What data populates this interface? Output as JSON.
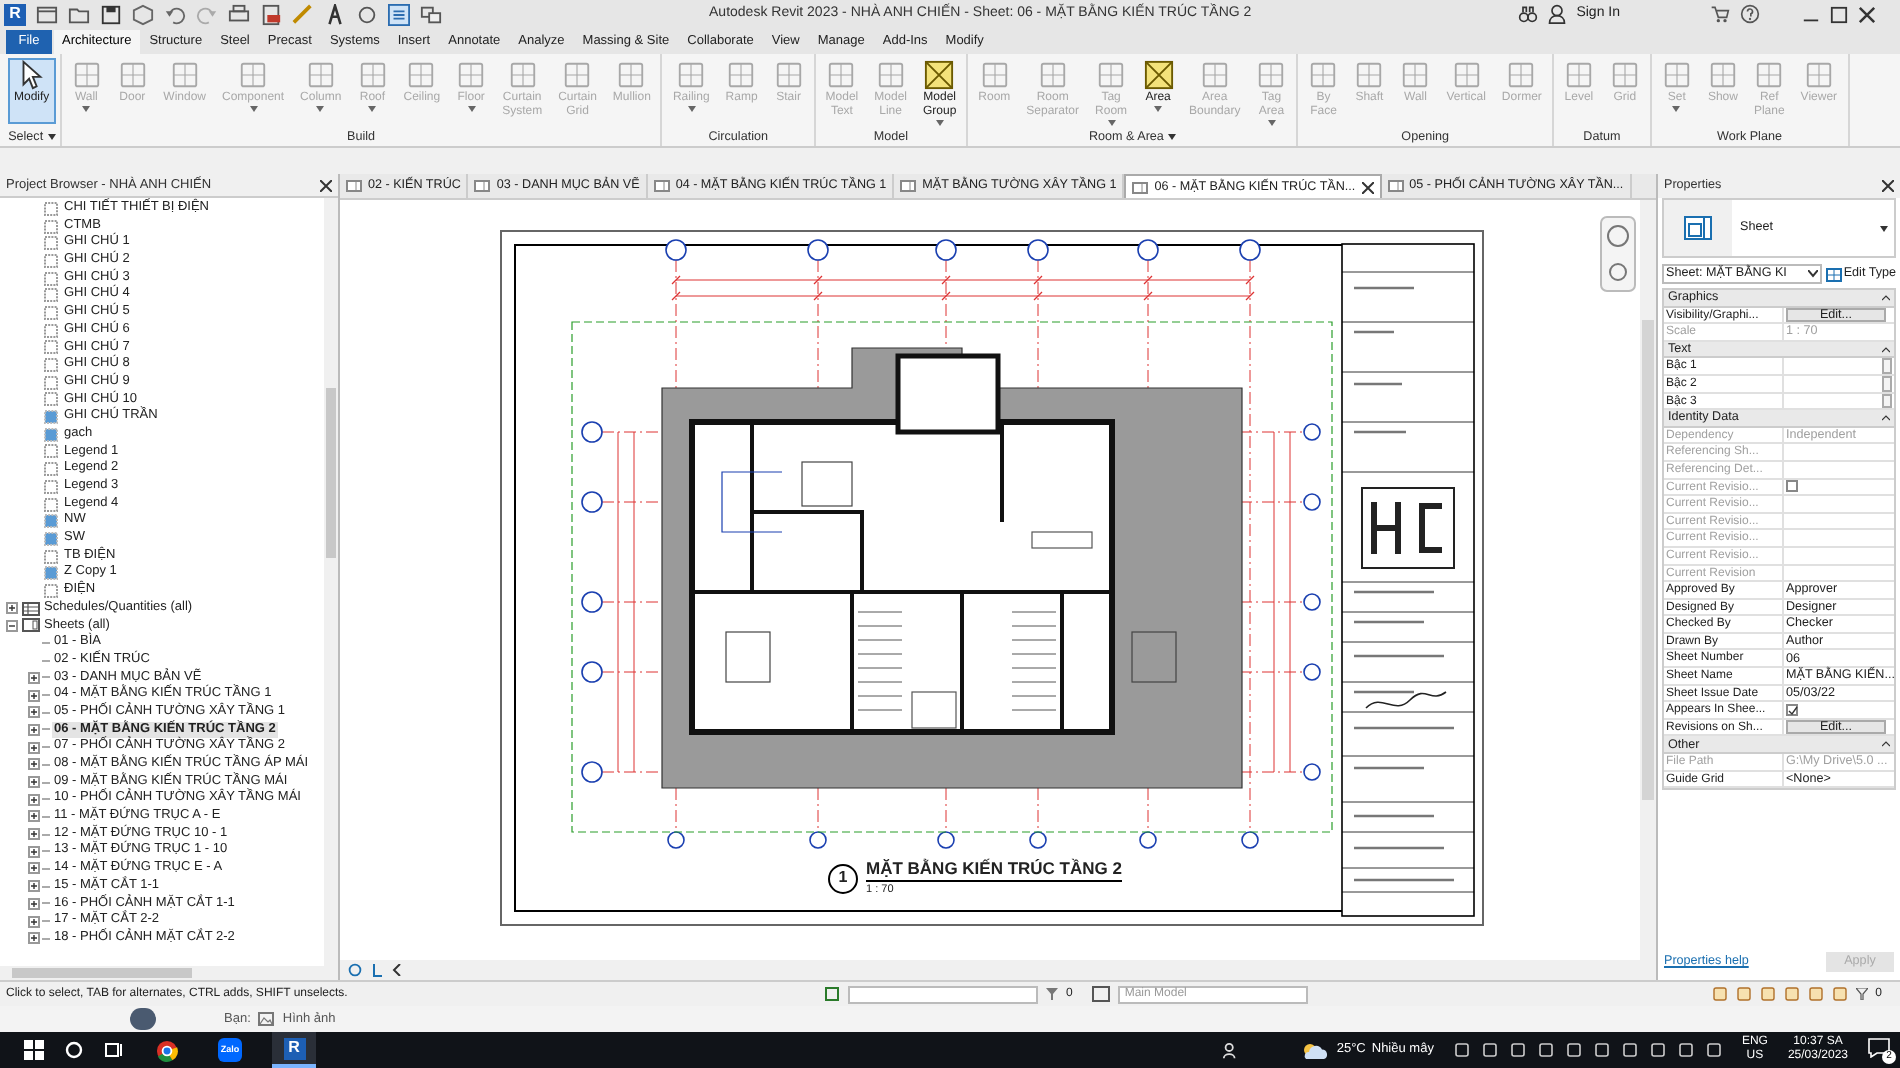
{
  "app": {
    "logo": "R",
    "title": "Autodesk Revit 2023 - NHÀ ANH CHIẾN - Sheet: 06 - MẶT BẰNG KIẾN TRÚC TẦNG 2",
    "sign_in": "Sign In"
  },
  "ribbon_tabs": [
    {
      "label": "File",
      "selected": false,
      "kind": "file"
    },
    {
      "label": "Architecture",
      "selected": true,
      "kind": "tab"
    },
    {
      "label": "Structure",
      "selected": false,
      "kind": "tab"
    },
    {
      "label": "Steel",
      "selected": false,
      "kind": "tab"
    },
    {
      "label": "Precast",
      "selected": false,
      "kind": "tab"
    },
    {
      "label": "Systems",
      "selected": false,
      "kind": "tab"
    },
    {
      "label": "Insert",
      "selected": false,
      "kind": "tab"
    },
    {
      "label": "Annotate",
      "selected": false,
      "kind": "tab"
    },
    {
      "label": "Analyze",
      "selected": false,
      "kind": "tab"
    },
    {
      "label": "Massing & Site",
      "selected": false,
      "kind": "tab"
    },
    {
      "label": "Collaborate",
      "selected": false,
      "kind": "tab"
    },
    {
      "label": "View",
      "selected": false,
      "kind": "tab"
    },
    {
      "label": "Manage",
      "selected": false,
      "kind": "tab"
    },
    {
      "label": "Add-Ins",
      "selected": false,
      "kind": "tab"
    },
    {
      "label": "Modify",
      "selected": false,
      "kind": "tab"
    }
  ],
  "ribbon_groups": [
    {
      "label": "Select",
      "menu": true,
      "buttons": [
        {
          "label": "Modify",
          "pressed": true,
          "disabled": false,
          "dropdown": false
        }
      ]
    },
    {
      "label": "Build",
      "menu": false,
      "buttons": [
        {
          "label": "Wall",
          "pressed": false,
          "disabled": true,
          "dropdown": true
        },
        {
          "label": "Door",
          "pressed": false,
          "disabled": true,
          "dropdown": false
        },
        {
          "label": "Window",
          "pressed": false,
          "disabled": true,
          "dropdown": false
        },
        {
          "label": "Component",
          "pressed": false,
          "disabled": true,
          "dropdown": true
        },
        {
          "label": "Column",
          "pressed": false,
          "disabled": true,
          "dropdown": true
        },
        {
          "label": "Roof",
          "pressed": false,
          "disabled": true,
          "dropdown": true
        },
        {
          "label": "Ceiling",
          "pressed": false,
          "disabled": true,
          "dropdown": false
        },
        {
          "label": "Floor",
          "pressed": false,
          "disabled": true,
          "dropdown": true
        },
        {
          "label": "Curtain System",
          "pressed": false,
          "disabled": true,
          "dropdown": false
        },
        {
          "label": "Curtain Grid",
          "pressed": false,
          "disabled": true,
          "dropdown": false
        },
        {
          "label": "Mullion",
          "pressed": false,
          "disabled": true,
          "dropdown": false
        }
      ]
    },
    {
      "label": "Circulation",
      "menu": false,
      "buttons": [
        {
          "label": "Railing",
          "pressed": false,
          "disabled": true,
          "dropdown": true
        },
        {
          "label": "Ramp",
          "pressed": false,
          "disabled": true,
          "dropdown": false
        },
        {
          "label": "Stair",
          "pressed": false,
          "disabled": true,
          "dropdown": false
        }
      ]
    },
    {
      "label": "Model",
      "menu": false,
      "buttons": [
        {
          "label": "Model Text",
          "pressed": false,
          "disabled": true,
          "dropdown": false
        },
        {
          "label": "Model Line",
          "pressed": false,
          "disabled": true,
          "dropdown": false
        },
        {
          "label": "Model Group",
          "pressed": false,
          "disabled": false,
          "dropdown": true
        }
      ]
    },
    {
      "label": "Room & Area",
      "menu": true,
      "buttons": [
        {
          "label": "Room",
          "pressed": false,
          "disabled": true,
          "dropdown": false
        },
        {
          "label": "Room Separator",
          "pressed": false,
          "disabled": true,
          "dropdown": false
        },
        {
          "label": "Tag Room",
          "pressed": false,
          "disabled": true,
          "dropdown": true
        },
        {
          "label": "Area",
          "pressed": false,
          "disabled": false,
          "dropdown": true
        },
        {
          "label": "Area Boundary",
          "pressed": false,
          "disabled": true,
          "dropdown": false
        },
        {
          "label": "Tag Area",
          "pressed": false,
          "disabled": true,
          "dropdown": true
        }
      ]
    },
    {
      "label": "Opening",
      "menu": false,
      "buttons": [
        {
          "label": "By Face",
          "pressed": false,
          "disabled": true,
          "dropdown": false
        },
        {
          "label": "Shaft",
          "pressed": false,
          "disabled": true,
          "dropdown": false
        },
        {
          "label": "Wall",
          "pressed": false,
          "disabled": true,
          "dropdown": false
        },
        {
          "label": "Vertical",
          "pressed": false,
          "disabled": true,
          "dropdown": false
        },
        {
          "label": "Dormer",
          "pressed": false,
          "disabled": true,
          "dropdown": false
        }
      ]
    },
    {
      "label": "Datum",
      "menu": false,
      "buttons": [
        {
          "label": "Level",
          "pressed": false,
          "disabled": true,
          "dropdown": false
        },
        {
          "label": "Grid",
          "pressed": false,
          "disabled": true,
          "dropdown": false
        }
      ]
    },
    {
      "label": "Work Plane",
      "menu": false,
      "buttons": [
        {
          "label": "Set",
          "pressed": false,
          "disabled": true,
          "dropdown": true
        },
        {
          "label": "Show",
          "pressed": false,
          "disabled": true,
          "dropdown": false
        },
        {
          "label": "Ref Plane",
          "pressed": false,
          "disabled": true,
          "dropdown": false
        },
        {
          "label": "Viewer",
          "pressed": false,
          "disabled": true,
          "dropdown": false
        }
      ]
    }
  ],
  "project_browser": {
    "title": "Project Browser - NHÀ ANH CHIẾN",
    "views": [
      {
        "label": "CHI TIẾT THIẾT BỊ ĐIỆN",
        "kind": "view"
      },
      {
        "label": "CTMB",
        "kind": "view"
      },
      {
        "label": "GHI CHÚ 1",
        "kind": "view"
      },
      {
        "label": "GHI CHÚ 2",
        "kind": "view"
      },
      {
        "label": "GHI CHÚ 3",
        "kind": "view"
      },
      {
        "label": "GHI CHÚ 4",
        "kind": "view"
      },
      {
        "label": "GHI CHÚ 5",
        "kind": "view"
      },
      {
        "label": "GHI CHÚ 6",
        "kind": "view"
      },
      {
        "label": "GHI CHÚ 7",
        "kind": "view"
      },
      {
        "label": "GHI CHÚ 8",
        "kind": "view"
      },
      {
        "label": "GHI CHÚ 9",
        "kind": "view"
      },
      {
        "label": "GHI CHÚ 10",
        "kind": "view"
      },
      {
        "label": "GHI CHÚ TRẦN",
        "kind": "view-filled"
      },
      {
        "label": "gach",
        "kind": "view-filled"
      },
      {
        "label": "Legend 1",
        "kind": "view"
      },
      {
        "label": "Legend 2",
        "kind": "view"
      },
      {
        "label": "Legend 3",
        "kind": "view"
      },
      {
        "label": "Legend 4",
        "kind": "view"
      },
      {
        "label": "NW",
        "kind": "view-filled"
      },
      {
        "label": "SW",
        "kind": "view-filled"
      },
      {
        "label": "TB ĐIỆN",
        "kind": "view"
      },
      {
        "label": "Z Copy 1",
        "kind": "view-filled"
      },
      {
        "label": "ĐIỆN",
        "kind": "view"
      }
    ],
    "nodes": [
      {
        "label": "Schedules/Quantities (all)",
        "kind": "schedules",
        "expanded": false
      },
      {
        "label": "Sheets (all)",
        "kind": "sheets",
        "expanded": true,
        "children": [
          {
            "label": "01 - BÌA",
            "has_children": false,
            "selected": false
          },
          {
            "label": "02 - KIẾN TRÚC",
            "has_children": false,
            "selected": false
          },
          {
            "label": "03 - DANH MỤC BẢN VẼ",
            "has_children": true,
            "selected": false
          },
          {
            "label": "04 - MẶT BẰNG KIẾN TRÚC TẦNG 1",
            "has_children": true,
            "selected": false
          },
          {
            "label": "05 - PHỐI CẢNH TƯỜNG XÂY TẦNG 1",
            "has_children": true,
            "selected": false
          },
          {
            "label": "06 - MẶT BẰNG KIẾN TRÚC TẦNG 2",
            "has_children": true,
            "selected": true
          },
          {
            "label": "07 - PHỐI CẢNH TƯỜNG XÂY TẦNG 2",
            "has_children": true,
            "selected": false
          },
          {
            "label": "08 - MẶT BẰNG KIẾN TRÚC TẦNG ÁP MÁI",
            "has_children": true,
            "selected": false
          },
          {
            "label": "09 - MẶT BẰNG KIẾN TRÚC TẦNG MÁI",
            "has_children": true,
            "selected": false
          },
          {
            "label": "10 - PHỐI CẢNH TƯỜNG XÂY TẦNG MÁI",
            "has_children": true,
            "selected": false
          },
          {
            "label": "11 - MẶT ĐỨNG TRỤC A - E",
            "has_children": true,
            "selected": false
          },
          {
            "label": "12 - MẶT ĐỨNG TRỤC 10 - 1",
            "has_children": true,
            "selected": false
          },
          {
            "label": "13 - MẶT ĐỨNG TRỤC 1 - 10",
            "has_children": true,
            "selected": false
          },
          {
            "label": "14 - MẶT ĐỨNG TRỤC E - A",
            "has_children": true,
            "selected": false
          },
          {
            "label": "15 - MẶT CẮT 1-1",
            "has_children": true,
            "selected": false
          },
          {
            "label": "16 - PHỐI CẢNH MẶT CẮT 1-1",
            "has_children": true,
            "selected": false
          },
          {
            "label": "17 - MẶT CẮT 2-2",
            "has_children": true,
            "selected": false
          },
          {
            "label": "18 - PHỐI CẢNH MẶT CẮT 2-2",
            "has_children": true,
            "selected": false
          }
        ]
      }
    ]
  },
  "view_tabs": [
    {
      "label": "02 - KIẾN TRÚC",
      "selected": false
    },
    {
      "label": "03 - DANH MỤC BẢN VẼ",
      "selected": false
    },
    {
      "label": "04 - MẶT BẰNG KIẾN TRÚC TẦNG 1",
      "selected": false
    },
    {
      "label": "MẶT BẰNG TƯỜNG XÂY TẦNG 1",
      "selected": false
    },
    {
      "label": "06 - MẶT BẰNG KIẾN TRÚC TẦN...",
      "selected": true
    },
    {
      "label": "05 - PHỐI CẢNH TƯỜNG XÂY TẦN...",
      "selected": false
    }
  ],
  "sheet_view": {
    "view_number": "1",
    "view_name": "MẶT BẰNG KIẾN TRÚC TẦNG 2",
    "scale": "1 : 70"
  },
  "properties": {
    "title": "Properties",
    "type_name": "Sheet",
    "instance_selector": "Sheet: MẶT BẰNG KI",
    "edit_type": "Edit Type",
    "groups": [
      {
        "name": "Graphics",
        "rows": [
          {
            "name": "Visibility/Graphi...",
            "kind": "button",
            "value": "Edit...",
            "disabled": false
          },
          {
            "name": "Scale",
            "kind": "text",
            "value": "1 : 70",
            "disabled": true
          }
        ]
      },
      {
        "name": "Text",
        "rows": [
          {
            "name": "Bậc 1",
            "kind": "field",
            "disabled": false
          },
          {
            "name": "Bậc 2",
            "kind": "field",
            "disabled": false
          },
          {
            "name": "Bậc 3",
            "kind": "field",
            "disabled": false
          }
        ]
      },
      {
        "name": "Identity Data",
        "rows": [
          {
            "name": "Dependency",
            "kind": "text",
            "value": "Independent",
            "disabled": true
          },
          {
            "name": "Referencing Sh...",
            "kind": "text",
            "disabled": true
          },
          {
            "name": "Referencing Det...",
            "kind": "text",
            "disabled": true
          },
          {
            "name": "Current Revisio...",
            "kind": "checkbox",
            "checked": false,
            "disabled": true
          },
          {
            "name": "Current Revisio...",
            "kind": "text",
            "disabled": true
          },
          {
            "name": "Current Revisio...",
            "kind": "text",
            "disabled": true
          },
          {
            "name": "Current Revisio...",
            "kind": "text",
            "disabled": true
          },
          {
            "name": "Current Revisio...",
            "kind": "text",
            "disabled": true
          },
          {
            "name": "Current Revision",
            "kind": "text",
            "disabled": true
          },
          {
            "name": "Approved By",
            "kind": "text",
            "value": "Approver",
            "disabled": false
          },
          {
            "name": "Designed By",
            "kind": "text",
            "value": "Designer",
            "disabled": false
          },
          {
            "name": "Checked By",
            "kind": "text",
            "value": "Checker",
            "disabled": false
          },
          {
            "name": "Drawn By",
            "kind": "text",
            "value": "Author",
            "disabled": false
          },
          {
            "name": "Sheet Number",
            "kind": "text",
            "value": "06",
            "disabled": false
          },
          {
            "name": "Sheet Name",
            "kind": "text",
            "value": "MẶT BẰNG KIẾN...",
            "disabled": false
          },
          {
            "name": "Sheet Issue Date",
            "kind": "text",
            "value": "05/03/22",
            "disabled": false
          },
          {
            "name": "Appears In Shee...",
            "kind": "checkbox",
            "checked": true,
            "disabled": false
          },
          {
            "name": "Revisions on Sh...",
            "kind": "button",
            "value": "Edit...",
            "disabled": false
          }
        ]
      },
      {
        "name": "Other",
        "rows": [
          {
            "name": "File Path",
            "kind": "text",
            "value": "G:\\My Drive\\5.0 ...",
            "disabled": true
          },
          {
            "name": "Guide Grid",
            "kind": "text",
            "value": "<None>",
            "disabled": false
          }
        ]
      }
    ],
    "help_link": "Properties help",
    "apply": {
      "label": "Apply",
      "disabled": true
    }
  },
  "status_bar": {
    "hint": "Click to select, TAB for alternates, CTRL adds, SHIFT unselects.",
    "count": "0",
    "model": "Main Model",
    "filter_count": "0"
  },
  "chat_preview": {
    "sender": "Bạn:",
    "text": "Hình ảnh"
  },
  "taskbar": {
    "apps": [
      {
        "kind": "chrome",
        "selected": false
      },
      {
        "kind": "zalo",
        "label": "Zalo",
        "selected": false
      },
      {
        "kind": "revit",
        "label": "R",
        "selected": true
      }
    ],
    "temperature": "25°C",
    "weather": "Nhiều mây",
    "language": "ENG",
    "region": "US",
    "time": "10:37 SA",
    "date": "25/03/2023",
    "notifications": "2"
  }
}
